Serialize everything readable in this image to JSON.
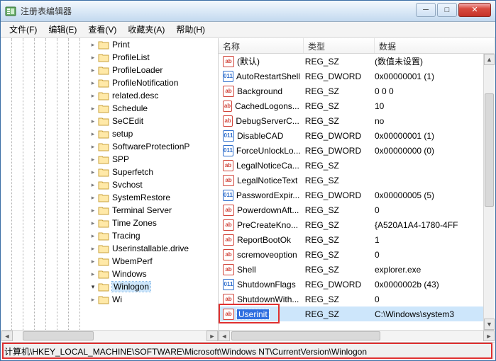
{
  "window": {
    "title": "注册表编辑器"
  },
  "menu": {
    "file": "文件(F)",
    "edit": "编辑(E)",
    "view": "查看(V)",
    "favorites": "收藏夹(A)",
    "help": "帮助(H)"
  },
  "winbtns": {
    "min": "─",
    "max": "□",
    "close": "✕"
  },
  "tree": {
    "items": [
      "Print",
      "ProfileList",
      "ProfileLoader",
      "ProfileNotification",
      "related.desc",
      "Schedule",
      "SeCEdit",
      "setup",
      "SoftwareProtectionP",
      "SPP",
      "Superfetch",
      "Svchost",
      "SystemRestore",
      "Terminal Server",
      "Time Zones",
      "Tracing",
      "Userinstallable.drive",
      "WbemPerf",
      "Windows",
      "Winlogon"
    ],
    "selected": "Winlogon",
    "partial_last": "Wi"
  },
  "list": {
    "headers": {
      "name": "名称",
      "type": "类型",
      "data": "数据"
    },
    "col_widths": {
      "name": 120,
      "type": 100,
      "data": 160
    },
    "rows": [
      {
        "icon": "str",
        "name": "(默认)",
        "type": "REG_SZ",
        "data": "(数值未设置)"
      },
      {
        "icon": "dw",
        "name": "AutoRestartShell",
        "type": "REG_DWORD",
        "data": "0x00000001 (1)"
      },
      {
        "icon": "str",
        "name": "Background",
        "type": "REG_SZ",
        "data": "0 0 0"
      },
      {
        "icon": "str",
        "name": "CachedLogons...",
        "type": "REG_SZ",
        "data": "10"
      },
      {
        "icon": "str",
        "name": "DebugServerC...",
        "type": "REG_SZ",
        "data": "no"
      },
      {
        "icon": "dw",
        "name": "DisableCAD",
        "type": "REG_DWORD",
        "data": "0x00000001 (1)"
      },
      {
        "icon": "dw",
        "name": "ForceUnlockLo...",
        "type": "REG_DWORD",
        "data": "0x00000000 (0)"
      },
      {
        "icon": "str",
        "name": "LegalNoticeCa...",
        "type": "REG_SZ",
        "data": ""
      },
      {
        "icon": "str",
        "name": "LegalNoticeText",
        "type": "REG_SZ",
        "data": ""
      },
      {
        "icon": "dw",
        "name": "PasswordExpir...",
        "type": "REG_DWORD",
        "data": "0x00000005 (5)"
      },
      {
        "icon": "str",
        "name": "PowerdownAft...",
        "type": "REG_SZ",
        "data": "0"
      },
      {
        "icon": "str",
        "name": "PreCreateKno...",
        "type": "REG_SZ",
        "data": "{A520A1A4-1780-4FF"
      },
      {
        "icon": "str",
        "name": "ReportBootOk",
        "type": "REG_SZ",
        "data": "1"
      },
      {
        "icon": "str",
        "name": "scremoveoption",
        "type": "REG_SZ",
        "data": "0"
      },
      {
        "icon": "str",
        "name": "Shell",
        "type": "REG_SZ",
        "data": "explorer.exe"
      },
      {
        "icon": "dw",
        "name": "ShutdownFlags",
        "type": "REG_DWORD",
        "data": "0x0000002b (43)"
      },
      {
        "icon": "str",
        "name": "ShutdownWith...",
        "type": "REG_SZ",
        "data": "0"
      },
      {
        "icon": "str",
        "name": "Userinit",
        "type": "REG_SZ",
        "data": "C:\\Windows\\system3",
        "selected": true
      }
    ]
  },
  "statusbar": {
    "path": "计算机\\HKEY_LOCAL_MACHINE\\SOFTWARE\\Microsoft\\Windows NT\\CurrentVersion\\Winlogon"
  },
  "scroll": {
    "left": "◄",
    "right": "►",
    "up": "▲",
    "down": "▼"
  }
}
